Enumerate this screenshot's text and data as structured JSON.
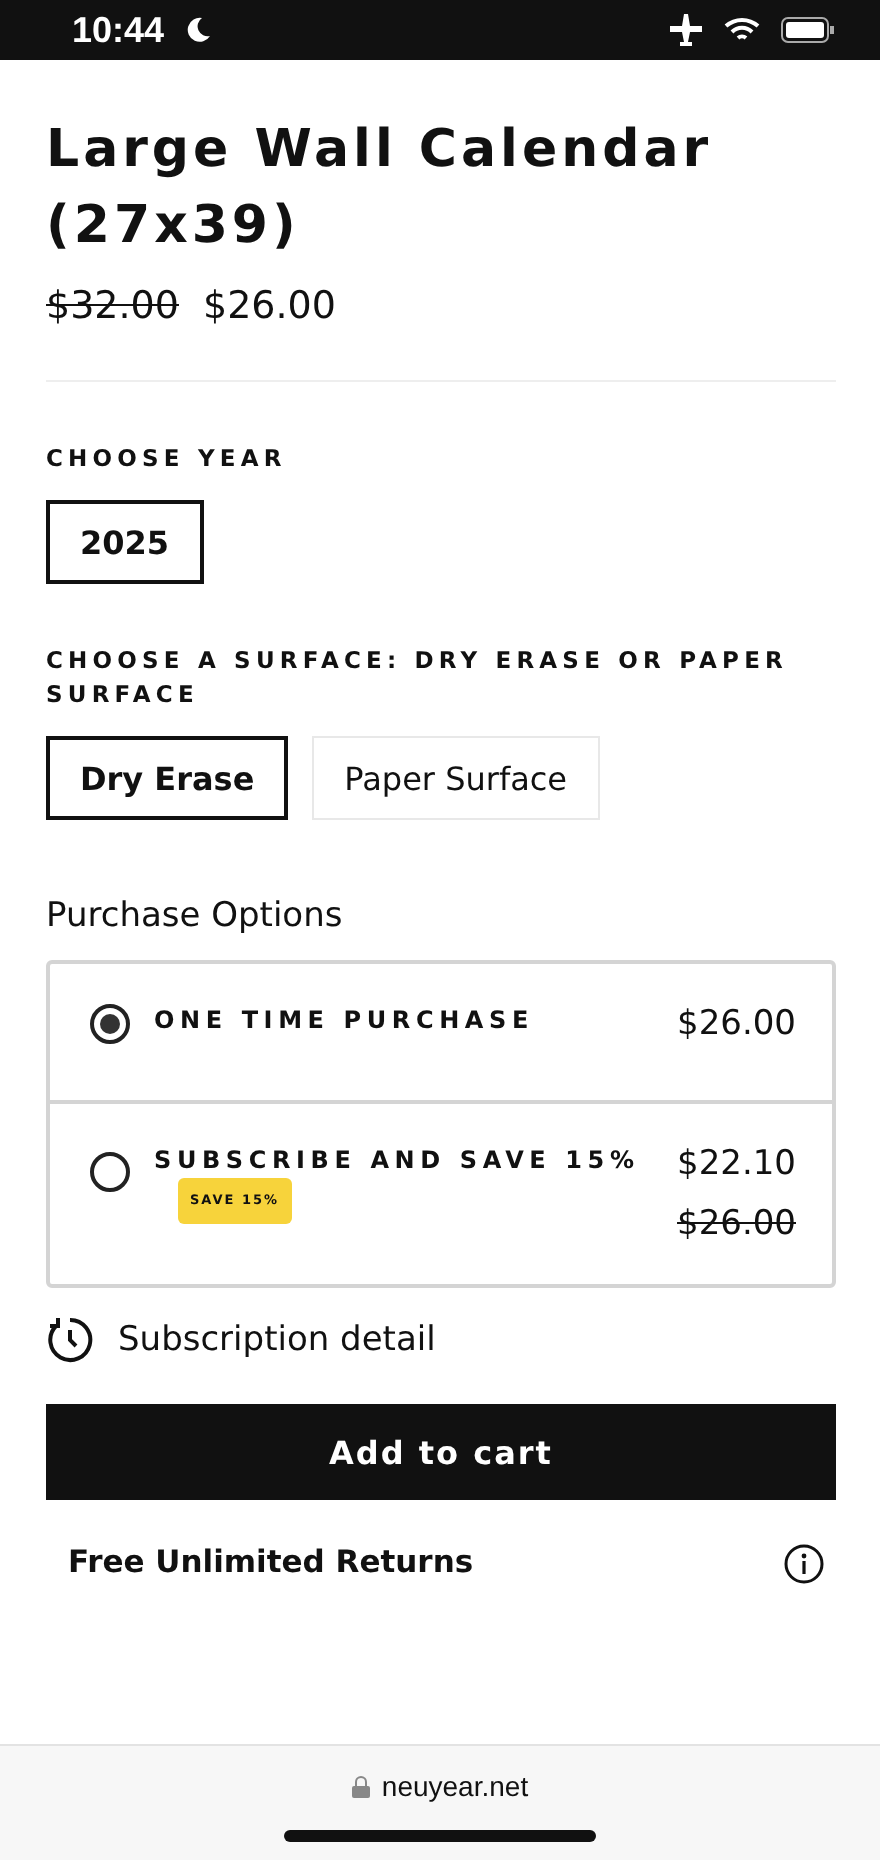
{
  "status_bar": {
    "time": "10:44"
  },
  "product": {
    "title_lines": [
      "Large Wall Calendar",
      "(27x39)"
    ],
    "compare_price": "$32.00",
    "price": "$26.00"
  },
  "year": {
    "label": "CHOOSE YEAR",
    "options": [
      {
        "label": "2025",
        "selected": true
      }
    ]
  },
  "surface": {
    "label": "CHOOSE A SURFACE: DRY ERASE OR PAPER SURFACE",
    "options": [
      {
        "label": "Dry Erase",
        "selected": true
      },
      {
        "label": "Paper Surface",
        "selected": false
      }
    ]
  },
  "purchase": {
    "label": "Purchase Options",
    "options": [
      {
        "title": "ONE TIME PURCHASE",
        "selected": true,
        "price": "$26.00"
      },
      {
        "title": "SUBSCRIBE AND SAVE 15%",
        "selected": false,
        "badge": "SAVE 15%",
        "price": "$22.10",
        "compare_price": "$26.00"
      }
    ]
  },
  "subscription_link": "Subscription detail",
  "add_to_cart": "Add to cart",
  "returns": "Free Unlimited Returns",
  "browser": {
    "url": "neuyear.net"
  }
}
